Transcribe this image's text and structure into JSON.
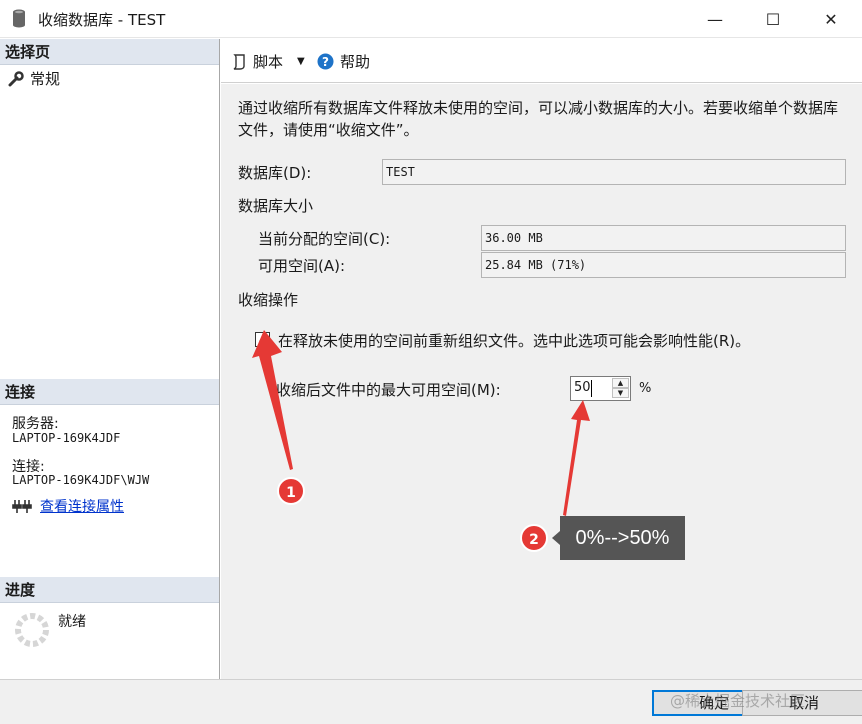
{
  "window": {
    "title": "收缩数据库 - TEST",
    "minimize": "—",
    "maximize": "☐",
    "close": "✕"
  },
  "left": {
    "select_page_header": "选择页",
    "pages": [
      {
        "label": "常规"
      }
    ],
    "connection_header": "连接",
    "server_label": "服务器:",
    "server_value": "LAPTOP-169K4JDF",
    "connection_label": "连接:",
    "connection_value": "LAPTOP-169K4JDF\\WJW",
    "view_properties_link": "查看连接属性",
    "progress_header": "进度",
    "progress_status": "就绪"
  },
  "toolbar": {
    "script_label": "脚本",
    "help_label": "帮助"
  },
  "main": {
    "description": "通过收缩所有数据库文件释放未使用的空间，可以减小数据库的大小。若要收缩单个数据库文件，请使用“收缩文件”。",
    "database_label": "数据库(D):",
    "database_value": "TEST",
    "db_size_heading": "数据库大小",
    "current_alloc_label": "当前分配的空间(C):",
    "current_alloc_value": "36.00 MB",
    "free_space_label": "可用空间(A):",
    "free_space_value": "25.84 MB (71%)",
    "shrink_heading": "收缩操作",
    "reorganize_checked": true,
    "reorganize_label": "在释放未使用的空间前重新组织文件。选中此选项可能会影响性能(R)。",
    "max_free_label": "收缩后文件中的最大可用空间(M):",
    "max_free_value": "50",
    "percent_unit": "%"
  },
  "buttons": {
    "ok": "确定",
    "cancel": "取消"
  },
  "annotations": {
    "badge1": "1",
    "badge2": "2",
    "callout": "0%-->50%",
    "arrow_color": "#e53935"
  },
  "watermark": "@稀土掘金技术社区"
}
